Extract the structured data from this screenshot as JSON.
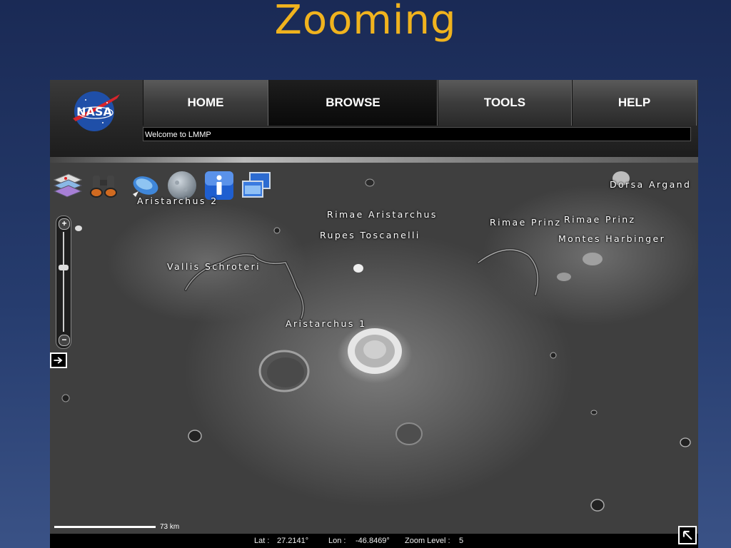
{
  "slide": {
    "title": "Zooming"
  },
  "nav": {
    "home": "HOME",
    "browse": "BROWSE",
    "tools": "TOOLS",
    "help": "HELP"
  },
  "welcome": "Welcome to LMMP",
  "labels": {
    "aristarchus2": "Aristarchus 2",
    "rimae_aristarchus": "Rimae Aristarchus",
    "rupes_toscanelli": "Rupes Toscanelli",
    "rimae_prinz_1": "Rimae Prinz",
    "rimae_prinz_2": "Rimae Prinz",
    "dorsa_argand": "Dorsa Argand",
    "montes_harbinger": "Montes Harbinger",
    "vallis_schroteri": "Vallis Schroteri",
    "aristarchus1": "Aristarchus 1"
  },
  "zoom_controls": {
    "plus": "+",
    "minus": "−"
  },
  "scale": {
    "label": "73 km"
  },
  "status": {
    "lat_label": "Lat :",
    "lat_value": "27.2141°",
    "lon_label": "Lon :",
    "lon_value": "-46.8469°",
    "zoom_label": "Zoom Level :",
    "zoom_value": "5"
  },
  "icons": {
    "layers": "layers-icon",
    "search": "binoculars-icon",
    "draw": "pen-icon",
    "globe": "moon-globe-icon",
    "info": "info-icon",
    "windows": "windows-icon",
    "expand": "arrow-right-icon",
    "corner": "resize-corner-icon"
  },
  "colors": {
    "title": "#f0b31e",
    "nasa_blue": "#1f4fa8",
    "nasa_red": "#d8242b"
  }
}
